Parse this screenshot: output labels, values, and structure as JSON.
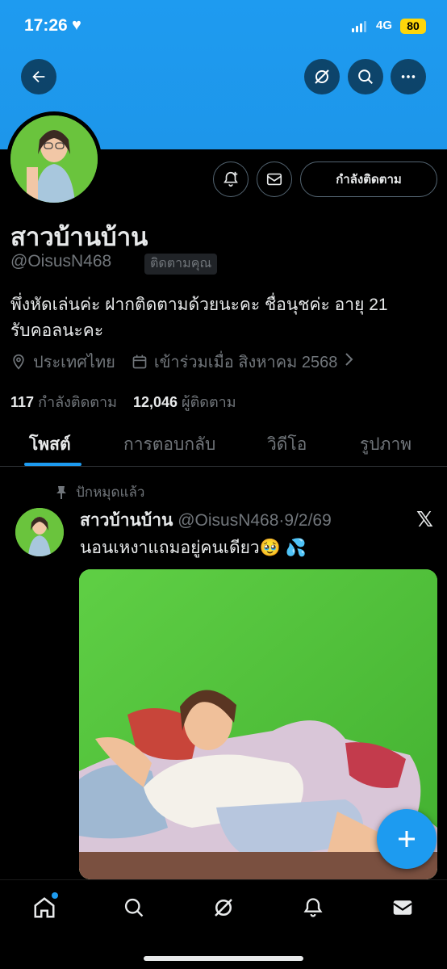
{
  "status_bar": {
    "time": "17:26",
    "network": "4G",
    "battery": "80"
  },
  "profile": {
    "name": "สาวบ้านบ้าน",
    "handle": "@OisusN468",
    "follows_you_badge": "ติดตามคุณ",
    "following_button": "กำลังติดตาม",
    "bio_line1": "พึ่งหัดเล่นค่ะ ฝากติดตามด้วยนะคะ ชื่อนุชค่ะ อายุ 21",
    "bio_line2": "รับคอลนะคะ",
    "location": "ประเทศไทย",
    "joined": "เข้าร่วมเมื่อ สิงหาคม 2568",
    "following_count": "117",
    "following_label": "กำลังติดตาม",
    "followers_count": "12,046",
    "followers_label": "ผู้ติดตาม"
  },
  "tabs": [
    {
      "label": "โพสต์",
      "active": true
    },
    {
      "label": "การตอบกลับ",
      "active": false
    },
    {
      "label": "วิดีโอ",
      "active": false
    },
    {
      "label": "รูปภาพ",
      "active": false
    }
  ],
  "tweet": {
    "pinned_label": "ปักหมุดแล้ว",
    "author_name": "สาวบ้านบ้าน",
    "author_handle": "@OisusN468",
    "date": "9/2/69",
    "text": "นอนเหงาแถมอยู่คนเดียว🥹 💦"
  },
  "icons": {
    "back": "back-arrow-icon",
    "grok": "grok-icon",
    "search": "search-icon",
    "more": "more-icon",
    "notify": "bell-plus-icon",
    "message": "envelope-icon",
    "location": "location-pin-icon",
    "calendar": "calendar-icon",
    "pin": "pin-icon",
    "x_logo": "x-logo-icon",
    "compose": "plus-icon"
  },
  "colors": {
    "accent": "#1d9bf0",
    "banner": "#1e9bf0",
    "muted": "#71767b",
    "battery": "#ffd60a"
  }
}
